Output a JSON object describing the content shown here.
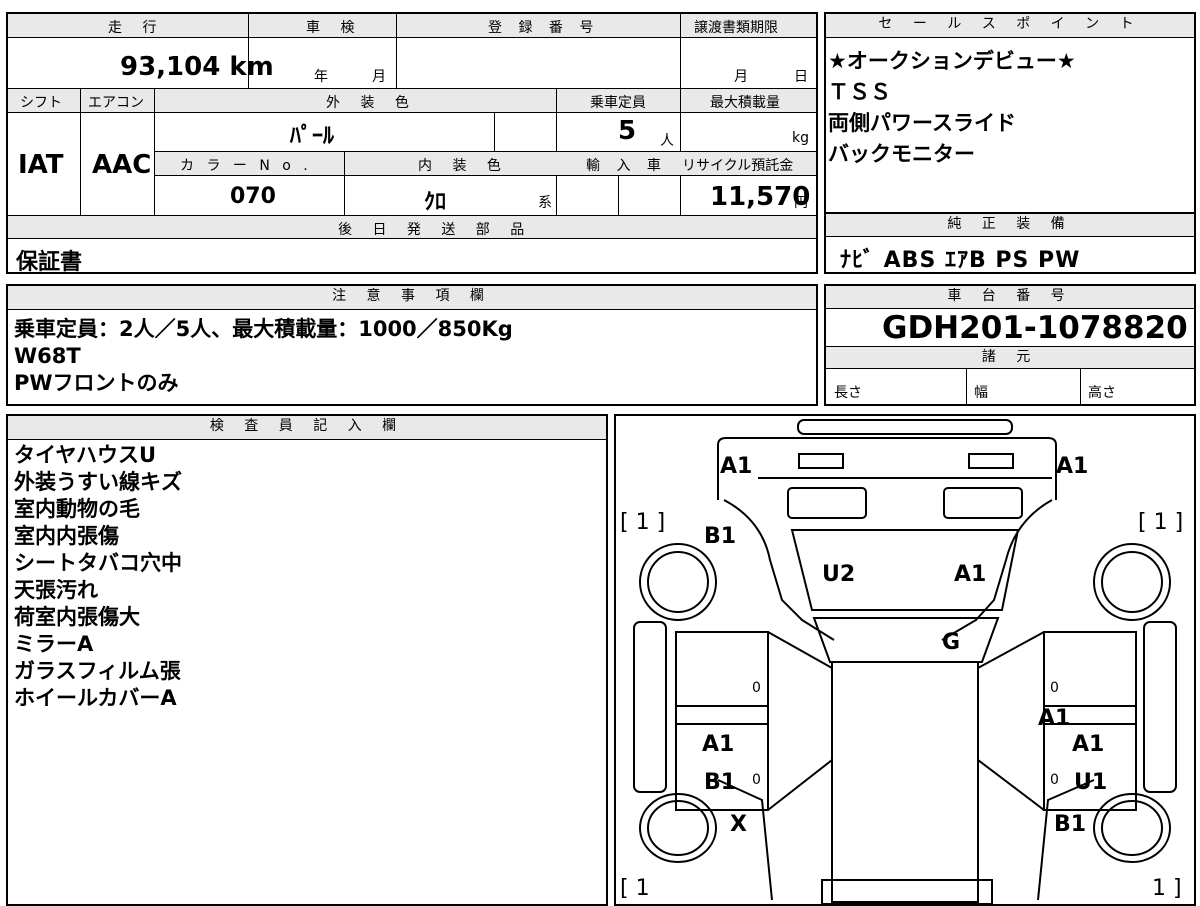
{
  "spec": {
    "headers": {
      "mileage": "走 行",
      "inspection": "車 検",
      "registration": "登 録 番 号",
      "transfer_deadline": "譲渡書類期限",
      "shift": "シフト",
      "aircon": "エアコン",
      "exterior_color": "外 装 色",
      "capacity": "乗車定員",
      "max_load": "最大積載量",
      "color_no": "カ ラ ー N o .",
      "interior_color": "内 装 色",
      "imported": "輸 入 車",
      "recycle_fee": "リサイクル預託金",
      "later_parts": "後 日 発 送 部 品"
    },
    "mileage": "93,104 km",
    "inspection_year": "年",
    "inspection_month": "月",
    "deadline_month": "月",
    "deadline_day": "日",
    "shift": "IAT",
    "aircon": "AAC",
    "exterior_color": "ﾊﾟｰﾙ",
    "capacity": "5",
    "capacity_unit": "人",
    "max_load_unit": "kg",
    "color_no": "070",
    "interior_color": "ｸﾛ",
    "interior_suffix": "系",
    "recycle_fee": "11,570",
    "recycle_unit": "円",
    "later_parts": "保証書"
  },
  "sales": {
    "header": "セ ー ル ス ポ イ ン ト",
    "points": [
      "★オークションデビュー★",
      "ＴＳＳ",
      "両側パワースライド",
      "バックモニター"
    ]
  },
  "equipment": {
    "header": "純 正 装 備",
    "value": "ﾅﾋﾞ ABS ｴｱB PS PW"
  },
  "notes": {
    "header": "注 意 事 項 欄",
    "lines": [
      "乗車定員：2人／5人、最大積載量：1000／850Kg",
      "W68T",
      "PWフロントのみ"
    ]
  },
  "chassis": {
    "header": "車 台 番 号",
    "number": "GDH201-1078820",
    "specs_header": "諸 元",
    "length": "長さ",
    "width": "幅",
    "height": "高さ"
  },
  "inspector": {
    "header": "検 査 員 記 入 欄",
    "lines": [
      "タイヤハウスU",
      "外装うすい線キズ",
      "室内動物の毛",
      "室内内張傷",
      "シートタバコ穴中",
      "天張汚れ",
      "荷室内張傷大",
      "ミラーA",
      "ガラスフィルム張",
      "ホイールカバーA"
    ]
  },
  "diagram": {
    "front_left": "A1",
    "front_right": "A1",
    "tire_front_left": "[ 1 ]",
    "tire_front_right": "[ 1 ]",
    "tire_rear_left": "[ 1",
    "tire_rear_right": "1 ]",
    "fender_left": "B1",
    "hood_left": "U2",
    "hood_right": "A1",
    "windshield": "G",
    "front_door_left_count": "0",
    "front_door_right_count": "0",
    "front_door_right": "A1",
    "rear_door_left_a": "A1",
    "rear_door_left_b": "B1",
    "rear_door_left_count": "0",
    "rear_door_right_a": "A1",
    "rear_door_right_b": "U1",
    "rear_door_right_count": "0",
    "rear_fender_left": "X",
    "rear_fender_right": "B1"
  }
}
